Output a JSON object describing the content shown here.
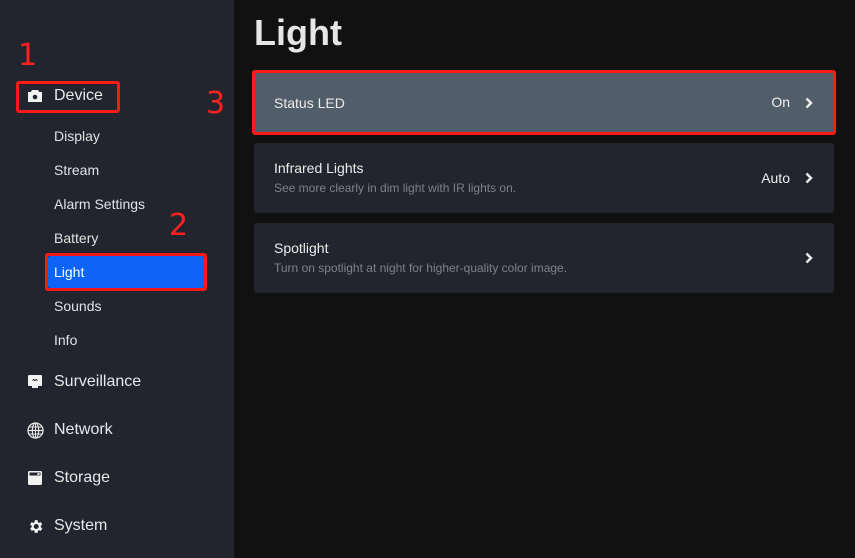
{
  "sidebar": {
    "sections": [
      {
        "label": "Device",
        "icon": "camera-icon"
      },
      {
        "label": "Surveillance",
        "icon": "monitor-icon"
      },
      {
        "label": "Network",
        "icon": "globe-icon"
      },
      {
        "label": "Storage",
        "icon": "storage-icon"
      },
      {
        "label": "System",
        "icon": "gear-icon"
      }
    ],
    "device_items": [
      {
        "label": "Display"
      },
      {
        "label": "Stream"
      },
      {
        "label": "Alarm Settings"
      },
      {
        "label": "Battery"
      },
      {
        "label": "Light",
        "active": true
      },
      {
        "label": "Sounds"
      },
      {
        "label": "Info"
      }
    ]
  },
  "main": {
    "title": "Light",
    "settings": [
      {
        "title": "Status LED",
        "description": "",
        "value": "On"
      },
      {
        "title": "Infrared Lights",
        "description": "See more clearly in dim light with IR lights on.",
        "value": "Auto"
      },
      {
        "title": "Spotlight",
        "description": "Turn on spotlight at night for higher-quality color image.",
        "value": ""
      }
    ]
  },
  "annotations": {
    "step1": "1",
    "step2": "2",
    "step3": "3",
    "color": "#ff1a1a"
  },
  "colors": {
    "accent": "#0d63f5",
    "sidebar_bg": "#22252d",
    "main_bg": "#111111",
    "selected_card": "#515d68"
  }
}
